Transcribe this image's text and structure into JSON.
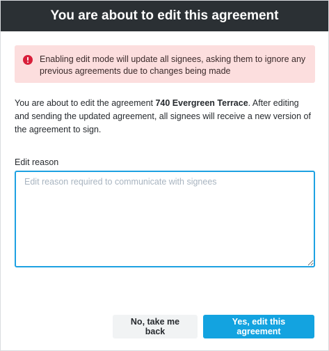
{
  "header": {
    "title": "You are about to edit this agreement"
  },
  "alert": {
    "icon": "alert-circle-icon",
    "color": "#d81f3a",
    "background": "#fcdede",
    "text": "Enabling edit mode will update all signees, asking them to ignore any previous agreements due to changes being made"
  },
  "description": {
    "prefix": "You are about to edit the agreement ",
    "agreement_name": "740 Evergreen Terrace",
    "suffix": ". After editing and sending the updated agreement, all signees will receive a new version of the agreement to sign."
  },
  "edit_reason": {
    "label": "Edit reason",
    "value": "",
    "placeholder": "Edit reason required to communicate with signees"
  },
  "actions": {
    "cancel_label": "No, take me back",
    "confirm_label": "Yes, edit this agreement"
  },
  "colors": {
    "header_bg": "#2b3034",
    "primary": "#13a3e0",
    "focus_border": "#1da1e2"
  }
}
